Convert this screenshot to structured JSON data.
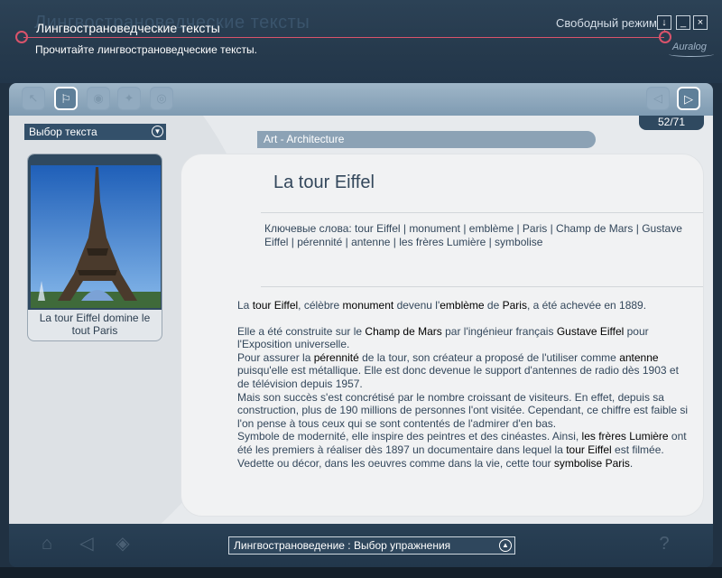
{
  "header": {
    "title": "Лингвострановедческие тексты",
    "subtitle": "Прочитайте лингвострановедческие тексты.",
    "mode_label": "Свободный режим",
    "brand": "Auralog",
    "download_glyph": "↓",
    "minimize_glyph": "_",
    "close_glyph": "×"
  },
  "toolbar": {
    "tools": [
      {
        "icon": "pointer-icon",
        "glyph": "↖"
      },
      {
        "icon": "flag-icon",
        "glyph": "⚐"
      },
      {
        "icon": "disc-icon",
        "glyph": "◉"
      },
      {
        "icon": "star-icon",
        "glyph": "✦"
      },
      {
        "icon": "globe-icon",
        "glyph": "◎"
      }
    ],
    "prev_glyph": "◁",
    "next_glyph": "▷",
    "page_counter": "52/71"
  },
  "sidebar": {
    "select_label": "Выбор текста",
    "image_caption": "La tour Eiffel domine le tout Paris"
  },
  "article": {
    "category": "Art - Architecture",
    "title": "La tour Eiffel",
    "keywords": "Ключевые слова: tour Eiffel | monument | emblème | Paris | Champ de Mars | Gustave Eiffel | pérennité | antenne | les frères Lumière | symbolise",
    "intro": [
      {
        "t": "La "
      },
      {
        "t": "tour Eiffel",
        "b": true
      },
      {
        "t": ", célèbre "
      },
      {
        "t": "monument",
        "b": true
      },
      {
        "t": " devenu l'"
      },
      {
        "t": "emblème",
        "b": true
      },
      {
        "t": " de "
      },
      {
        "t": "Paris",
        "b": true
      },
      {
        "t": ", a été achevée en 1889."
      }
    ],
    "body": [
      {
        "t": "Elle a été construite sur le "
      },
      {
        "t": "Champ de Mars",
        "b": true
      },
      {
        "t": " par l'ingénieur français "
      },
      {
        "t": "Gustave Eiffel",
        "b": true
      },
      {
        "t": " pour l'Exposition universelle.\nPour assurer la "
      },
      {
        "t": "pérennité",
        "b": true
      },
      {
        "t": " de la tour, son créateur a proposé de l'utiliser comme "
      },
      {
        "t": "antenne",
        "b": true
      },
      {
        "t": " puisqu'elle est métallique. Elle est donc devenue le support d'antennes de radio dès 1903 et de télévision depuis 1957.\nMais son succès s'est concrétisé par le nombre croissant de visiteurs. En effet, depuis sa construction, plus de 190 millions de personnes l'ont visitée. Cependant, ce chiffre est faible si l'on pense à tous ceux qui se sont contentés de l'admirer d'en bas.\nSymbole de modernité, elle inspire des peintres et des cinéastes. Ainsi, "
      },
      {
        "t": "les frères Lumière",
        "b": true
      },
      {
        "t": " ont été les premiers à réaliser dès 1897 un documentaire dans lequel la "
      },
      {
        "t": "tour Eiffel",
        "b": true
      },
      {
        "t": " est filmée. Vedette ou décor, dans les oeuvres comme dans la vie, cette tour "
      },
      {
        "t": "symbolise",
        "b": true
      },
      {
        "t": " "
      },
      {
        "t": "Paris",
        "b": true
      },
      {
        "t": "."
      }
    ]
  },
  "footer": {
    "exercise_select": "Лингвострановедение : Выбор упражнения"
  },
  "colors": {
    "accent_red": "#d9536b",
    "panel_dark": "#2f4960",
    "content_bg": "#e7eaed"
  }
}
